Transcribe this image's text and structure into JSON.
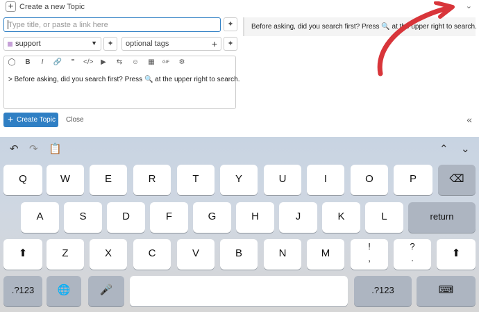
{
  "composer": {
    "add_icon": "+",
    "title": "Create a new Topic",
    "collapse_icon": "chevron-down",
    "title_placeholder": "Type title, or paste a link here",
    "category": {
      "label": "support",
      "color": "#c6a1d8"
    },
    "tags_placeholder": "optional tags",
    "editor_text": "> Before asking, did you search first? Press",
    "editor_text_tail": "at the upper right to search.",
    "preview_text": "Before asking, did you search first? Press",
    "preview_text_tail": "at the upper right to search.",
    "create_button": "Create Topic",
    "close_link": "Close",
    "toolbar": [
      "speech-bubble",
      "B",
      "I",
      "link",
      "quote",
      "code",
      "video",
      "upload",
      "swap",
      "emoji",
      "calendar",
      "GIF",
      "gear"
    ],
    "gif_label": "GIF",
    "accent": "#2f7fc4"
  },
  "keyboard": {
    "row1": [
      "Q",
      "W",
      "E",
      "R",
      "T",
      "Y",
      "U",
      "I",
      "O",
      "P"
    ],
    "row2": [
      "A",
      "S",
      "D",
      "F",
      "G",
      "H",
      "J",
      "K",
      "L"
    ],
    "row3": [
      "Z",
      "X",
      "C",
      "V",
      "B",
      "N",
      "M"
    ],
    "punct1": {
      "top": "!",
      "bottom": ","
    },
    "punct2": {
      "top": "?",
      "bottom": "."
    },
    "return_label": "return",
    "numbers_label": ".?123"
  }
}
